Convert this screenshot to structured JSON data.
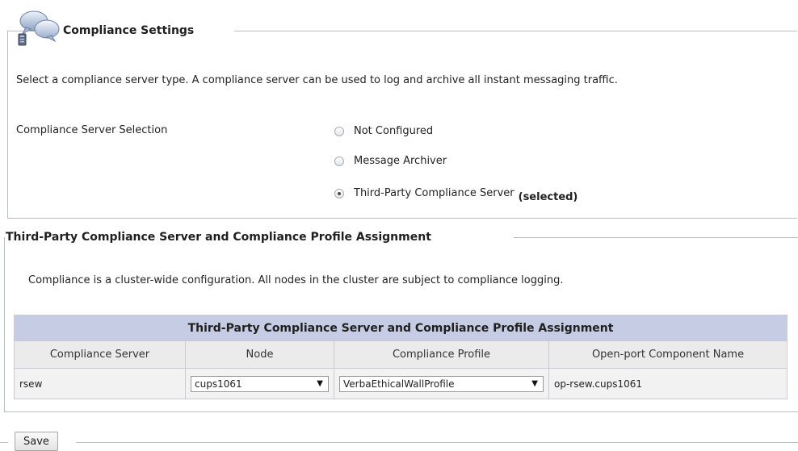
{
  "compliance_settings": {
    "title": "Compliance Settings",
    "description": "Select a compliance server type. A compliance server can be used to log and archive all instant messaging traffic.",
    "selection_label": "Compliance Server Selection",
    "options": [
      {
        "label": "Not Configured",
        "checked": false
      },
      {
        "label": "Message Archiver",
        "checked": false
      },
      {
        "label": "Third-Party Compliance Server",
        "checked": true
      }
    ],
    "selected_note": "(selected)"
  },
  "assignment": {
    "title": "Third-Party Compliance Server and Compliance Profile Assignment",
    "description": "Compliance is a cluster-wide configuration. All nodes in the cluster are subject to compliance logging.",
    "table": {
      "caption": "Third-Party Compliance Server and Compliance Profile Assignment",
      "columns": [
        "Compliance Server",
        "Node",
        "Compliance Profile",
        "Open-port Component Name"
      ],
      "rows": [
        {
          "server": "rsew",
          "node": "cups1061",
          "profile": "VerbaEthicalWallProfile",
          "component": "op-rsew.cups1061"
        }
      ]
    }
  },
  "actions": {
    "save_label": "Save"
  },
  "colors": {
    "table_caption_bg": "#c5cce3",
    "frame_border": "#b8bcc4"
  }
}
